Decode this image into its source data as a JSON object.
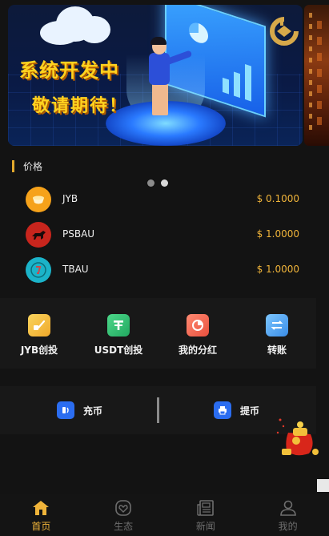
{
  "banner": {
    "line1": "系统开发中",
    "line2": "敬请期待！"
  },
  "carousel": {
    "slides": 2,
    "active_index": 1
  },
  "price_section": {
    "title": "价格",
    "coins": [
      {
        "name": "JYB",
        "price": "$ 0.1000",
        "icon": "jyb-coin-icon",
        "color": "#f6a21a"
      },
      {
        "name": "PSBAU",
        "price": "$ 1.0000",
        "icon": "psbau-coin-icon",
        "color": "#c8251d"
      },
      {
        "name": "TBAU",
        "price": "$ 1.0000",
        "icon": "tbau-coin-icon",
        "color": "#1bb3c9"
      }
    ]
  },
  "actions": [
    {
      "label": "JYB创投",
      "icon": "wallet-icon",
      "color": "#f5c33b"
    },
    {
      "label": "USDT创投",
      "icon": "tether-icon",
      "color": "#2fbf71"
    },
    {
      "label": "我的分红",
      "icon": "pie-chart-icon",
      "color": "#f06a58"
    },
    {
      "label": "转账",
      "icon": "transfer-icon",
      "color": "#4aa3f0"
    }
  ],
  "funds": {
    "deposit_label": "充币",
    "withdraw_label": "提币"
  },
  "tabbar": {
    "items": [
      {
        "label": "首页",
        "icon": "home-icon",
        "active": true
      },
      {
        "label": "生态",
        "icon": "ecology-icon",
        "active": false
      },
      {
        "label": "新闻",
        "icon": "news-icon",
        "active": false
      },
      {
        "label": "我的",
        "icon": "profile-icon",
        "active": false
      }
    ]
  },
  "colors": {
    "accent": "#f0b43a",
    "background": "#131313",
    "panel": "#181818"
  }
}
